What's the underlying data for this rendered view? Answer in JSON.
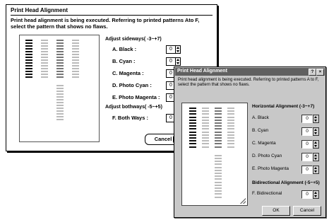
{
  "mac_dialog": {
    "title": "Print Head Alignment",
    "instructions": "Print head alignment is being executed. Referring to printed patterns Ato F, select the pattern that shows no flaws.",
    "sideways_section": "Adjust sideways( -3~+7)",
    "rows": [
      {
        "label": "A. Black :",
        "value": "0"
      },
      {
        "label": "B. Cyan :",
        "value": "0"
      },
      {
        "label": "C. Magenta :",
        "value": "0"
      },
      {
        "label": "D. Photo Cyan :",
        "value": "0"
      },
      {
        "label": "E. Photo Magenta :",
        "value": "0"
      }
    ],
    "bothways_section": "Adjust bothways( -5~+5)",
    "bothways_row": {
      "label": "F. Both Ways :",
      "value": "0"
    },
    "cancel_label": "Cancel"
  },
  "win_dialog": {
    "title": "Print Head Alignment",
    "close_glyph": "×",
    "help_glyph": "?",
    "instructions": "Print head alignment is being executed. Referring to printed patterns A to F, select the pattern that shows no flaws.",
    "sideways_section": "Horizontal Alignment (-3~+7)",
    "rows": [
      {
        "label": "A. Black",
        "value": "0"
      },
      {
        "label": "B. Cyan",
        "value": "0"
      },
      {
        "label": "C. Magenta",
        "value": "0"
      },
      {
        "label": "D. Photo Cyan",
        "value": "0"
      },
      {
        "label": "E. Photo Magenta",
        "value": "0"
      }
    ],
    "bothways_section": "Bidirectional Alignment (-5~+5)",
    "bothways_row": {
      "label": "F. Bidirectional",
      "value": "0"
    },
    "ok_label": "OK",
    "cancel_label": "Cancel"
  },
  "colors": {
    "pattern_dark": "#111111",
    "pattern_mid": "#777777",
    "pattern_light": "#bbbbbb",
    "win_face": "#c8c8c8",
    "win_titlebar": "#606060"
  }
}
